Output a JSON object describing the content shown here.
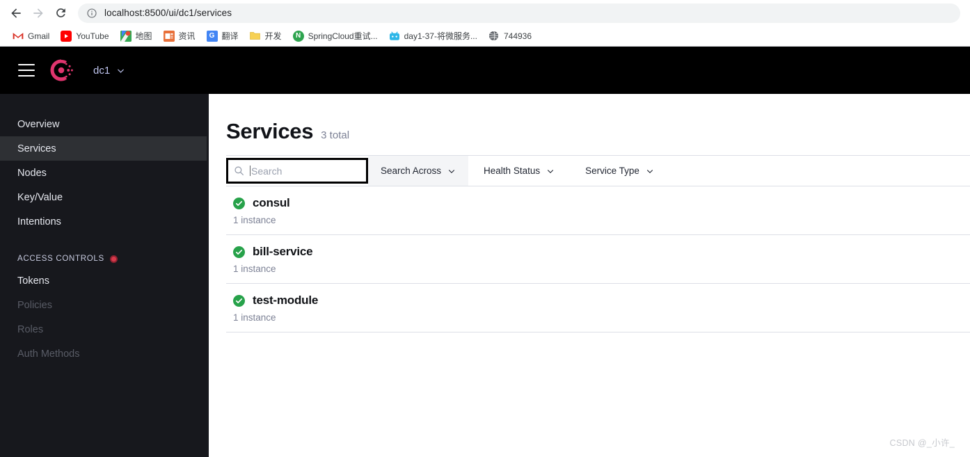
{
  "browser": {
    "back_icon": "back-arrow-icon",
    "forward_icon": "forward-arrow-icon",
    "reload_icon": "reload-icon",
    "site_info_icon": "info-circle-icon",
    "url": "localhost:8500/ui/dc1/services",
    "bookmarks": [
      {
        "label": "Gmail",
        "icon": "gmail-icon",
        "glyph": "M",
        "color": "#d93025",
        "bg": "#ffffff"
      },
      {
        "label": "YouTube",
        "icon": "youtube-icon",
        "glyph": "▶",
        "color": "#ffffff",
        "bg": "#ff0000"
      },
      {
        "label": "地图",
        "icon": "google-maps-icon",
        "glyph": "◉",
        "color": "#ea4335",
        "bg": "#34a853"
      },
      {
        "label": "资讯",
        "icon": "news-icon",
        "glyph": "▤",
        "color": "#ffffff",
        "bg": "#e8703a"
      },
      {
        "label": "翻译",
        "icon": "translate-icon",
        "glyph": "G",
        "color": "#ffffff",
        "bg": "#4285f4"
      },
      {
        "label": "开发",
        "icon": "folder-icon",
        "glyph": "",
        "color": "#5f6368",
        "bg": "#f5c33b"
      },
      {
        "label": "SpringCloud重试...",
        "icon": "notion-icon",
        "glyph": "N",
        "color": "#ffffff",
        "bg": "#2ea44f"
      },
      {
        "label": "day1-37-将微服务...",
        "icon": "bilibili-icon",
        "glyph": "■",
        "color": "#ffffff",
        "bg": "#2eb7e8"
      },
      {
        "label": "744936",
        "icon": "globe-icon",
        "glyph": "⊕",
        "color": "#ffffff",
        "bg": "#5f6368"
      }
    ]
  },
  "topnav": {
    "menu_icon": "hamburger-menu-icon",
    "logo_icon": "consul-logo-icon",
    "datacenter": "dc1",
    "datacenter_chevron_icon": "chevron-down-icon",
    "brand_color": "#e0356e"
  },
  "sidebar": {
    "items": [
      {
        "label": "Overview",
        "state": "normal"
      },
      {
        "label": "Services",
        "state": "active"
      },
      {
        "label": "Nodes",
        "state": "normal"
      },
      {
        "label": "Key/Value",
        "state": "normal"
      },
      {
        "label": "Intentions",
        "state": "normal"
      }
    ],
    "section": {
      "label": "ACCESS CONTROLS",
      "badge_icon": "status-dot-icon",
      "badge_color": "#d63a4c"
    },
    "acl_items": [
      {
        "label": "Tokens",
        "state": "normal"
      },
      {
        "label": "Policies",
        "state": "disabled"
      },
      {
        "label": "Roles",
        "state": "disabled"
      },
      {
        "label": "Auth Methods",
        "state": "disabled"
      }
    ]
  },
  "main": {
    "title": "Services",
    "total": "3 total",
    "search": {
      "icon": "search-icon",
      "placeholder": "Search",
      "value": ""
    },
    "filters": [
      {
        "label": "Search Across",
        "icon": "chevron-down-icon",
        "style": "filled"
      },
      {
        "label": "Health Status",
        "icon": "chevron-down-icon",
        "style": "plain"
      },
      {
        "label": "Service Type",
        "icon": "chevron-down-icon",
        "style": "plain"
      }
    ],
    "services": [
      {
        "name": "consul",
        "instances": "1 instance",
        "health": "passing",
        "health_icon": "check-circle-icon"
      },
      {
        "name": "bill-service",
        "instances": "1 instance",
        "health": "passing",
        "health_icon": "check-circle-icon"
      },
      {
        "name": "test-module",
        "instances": "1 instance",
        "health": "passing",
        "health_icon": "check-circle-icon"
      }
    ],
    "health_color": "#27a24a",
    "watermark": "CSDN @_小许_"
  }
}
